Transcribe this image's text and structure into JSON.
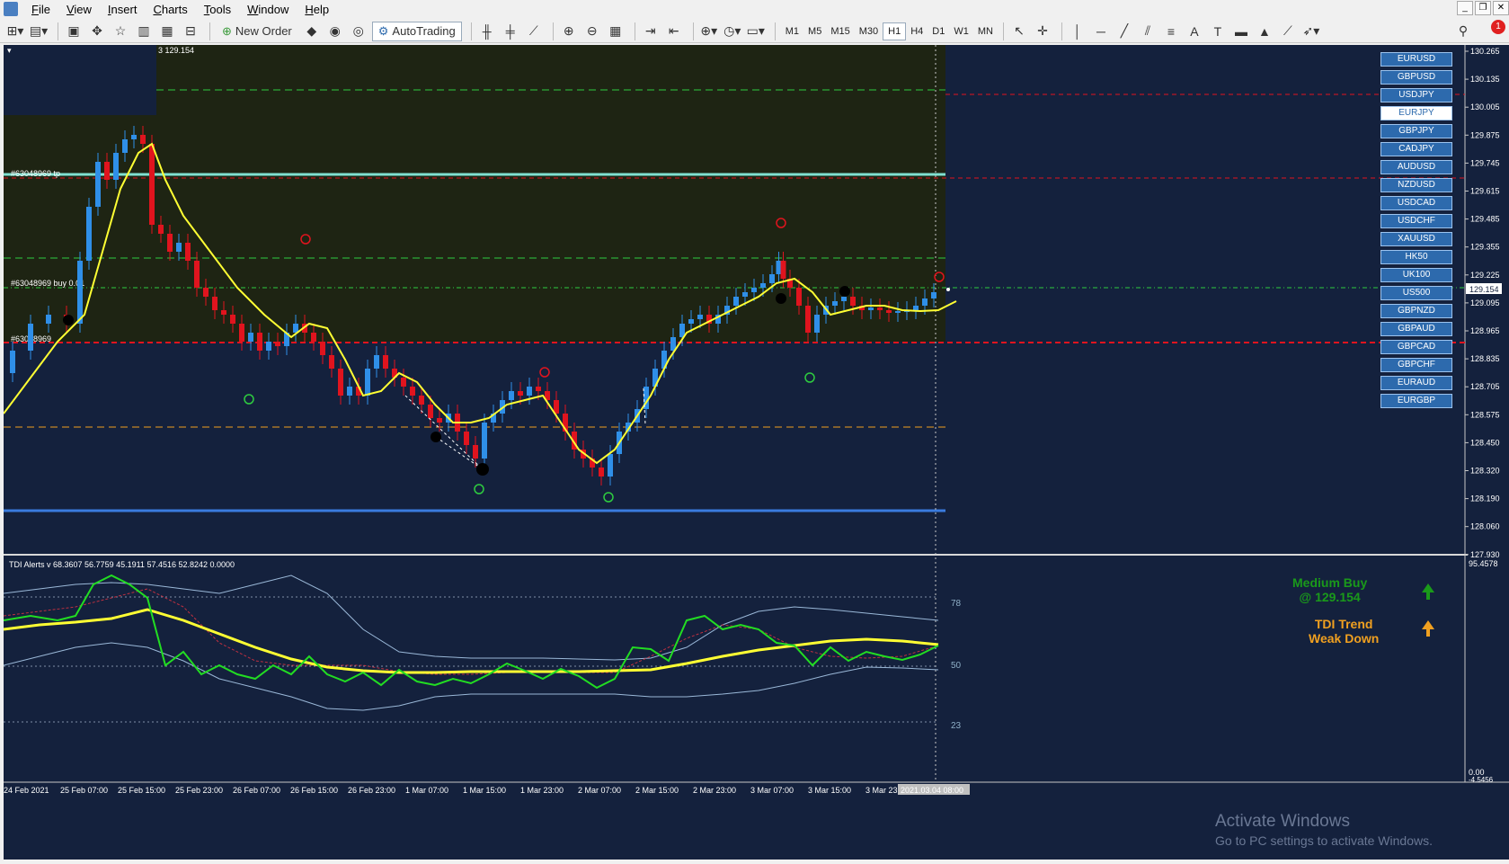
{
  "menu": [
    "File",
    "View",
    "Insert",
    "Charts",
    "Tools",
    "Window",
    "Help"
  ],
  "toolbar": {
    "new_order": "New Order",
    "autotrading": "AutoTrading",
    "timeframes": [
      "M1",
      "M5",
      "M15",
      "M30",
      "H1",
      "H4",
      "D1",
      "W1",
      "MN"
    ],
    "active_timeframe": "H1",
    "notification_count": "1"
  },
  "chart": {
    "price_header": "3 129.154",
    "current_price": "129.154",
    "price_axis": [
      "130.265",
      "130.135",
      "130.005",
      "129.875",
      "129.745",
      "129.615",
      "129.485",
      "129.355",
      "129.225",
      "129.095",
      "128.965",
      "128.835",
      "128.705",
      "128.575",
      "128.450",
      "128.320",
      "128.190",
      "128.060",
      "127.930"
    ],
    "order_labels": {
      "tp": "#63048969 tp",
      "buy": "#63048969 buy 0.01",
      "sl": "#63048969"
    },
    "time_axis": [
      "24 Feb 2021",
      "25 Feb 07:00",
      "25 Feb 15:00",
      "25 Feb 23:00",
      "26 Feb 07:00",
      "26 Feb 15:00",
      "26 Feb 23:00",
      "1 Mar 07:00",
      "1 Mar 15:00",
      "1 Mar 23:00",
      "2 Mar 07:00",
      "2 Mar 15:00",
      "2 Mar 23:00",
      "3 Mar 07:00",
      "3 Mar 15:00",
      "3 Mar 23:00"
    ],
    "crosshair_time": "2021.03.04 08:00",
    "colors": {
      "bull": "#2f8fe8",
      "bear": "#e0141e",
      "ma": "#ffff33",
      "background": "#14213d",
      "zone": "#1e2413"
    }
  },
  "symbols": [
    "EURUSD",
    "GBPUSD",
    "USDJPY",
    "EURJPY",
    "GBPJPY",
    "CADJPY",
    "AUDUSD",
    "NZDUSD",
    "USDCAD",
    "USDCHF",
    "XAUUSD",
    "HK50",
    "UK100",
    "US500",
    "GBPNZD",
    "GBPAUD",
    "GBPCAD",
    "GBPCHF",
    "EURAUD",
    "EURGBP"
  ],
  "selected_symbol": "EURJPY",
  "indicator": {
    "header": "TDI Alerts v 68.3607 56.7759 45.1911 57.4516 52.8242 0.0000",
    "axis_top": "95.4578",
    "axis_bottom": "0.00",
    "axis_bottom2": "-4.5456",
    "levels": [
      "78",
      "50",
      "23"
    ],
    "signal_line1": "Medium Buy",
    "signal_line2": "@ 129.154",
    "trend_line1": "TDI Trend",
    "trend_line2": "Weak Down"
  },
  "watermark": {
    "line1": "Activate Windows",
    "line2": "Go to PC settings to activate Windows."
  }
}
